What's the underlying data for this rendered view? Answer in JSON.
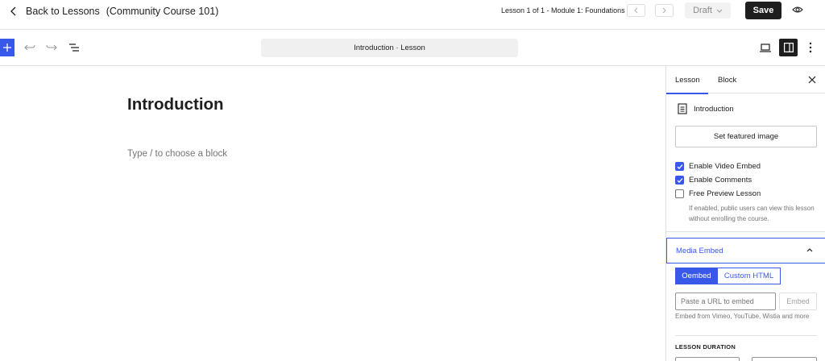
{
  "header": {
    "back_label": "Back to Lessons",
    "course_name": "(Community Course 101)",
    "lesson_position": "Lesson 1 of 1 - Module 1: Foundations",
    "status_label": "Draft",
    "save_label": "Save"
  },
  "toolbar": {
    "document_title": "Introduction · Lesson"
  },
  "editor": {
    "title": "Introduction",
    "placeholder": "Type / to choose a block"
  },
  "sidebar": {
    "tabs": [
      {
        "label": "Lesson",
        "active": true
      },
      {
        "label": "Block",
        "active": false
      }
    ],
    "lesson_name": "Introduction",
    "featured_image_label": "Set featured image",
    "checkboxes": [
      {
        "label": "Enable Video Embed",
        "checked": true
      },
      {
        "label": "Enable Comments",
        "checked": true
      },
      {
        "label": "Free Preview Lesson",
        "checked": false
      }
    ],
    "preview_help": "If enabled, public users can view this lesson without enrolling the course.",
    "media_embed": {
      "title": "Media Embed",
      "modes": [
        {
          "label": "Oembed",
          "active": true
        },
        {
          "label": "Custom HTML",
          "active": false
        }
      ],
      "url_placeholder": "Paste a URL to embed",
      "embed_label": "Embed",
      "help": "Embed from Vimeo, YouTube, Wistia and more"
    },
    "duration_label": "LESSON DURATION"
  },
  "colors": {
    "accent": "#3858e9",
    "dark": "#1e1e1e",
    "muted": "#757575"
  },
  "icons": [
    "chevron-left-icon",
    "chevron-right-icon",
    "chevron-down-icon",
    "eye-icon",
    "plus-icon",
    "undo-icon",
    "redo-icon",
    "list-view-icon",
    "desktop-view-icon",
    "sidebar-toggle-icon",
    "more-vertical-icon",
    "close-icon",
    "document-icon",
    "check-icon",
    "chevron-up-icon"
  ]
}
